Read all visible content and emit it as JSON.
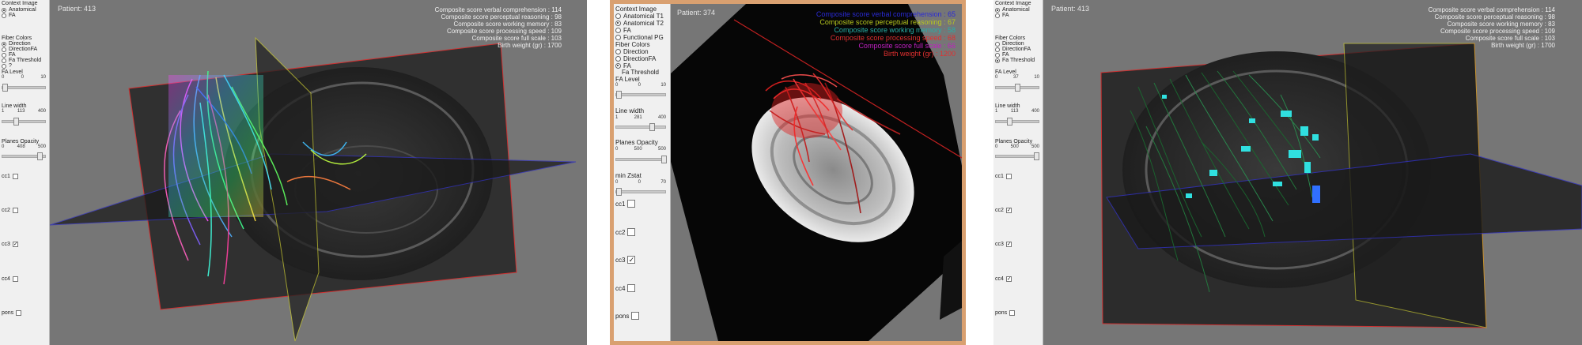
{
  "panel1": {
    "patient": "Patient: 413",
    "context_image": {
      "label": "Context Image",
      "options": [
        {
          "label": "Anatomical",
          "selected": true
        },
        {
          "label": "FA",
          "selected": false
        }
      ]
    },
    "fiber_colors": {
      "label": "Fiber Colors",
      "options": [
        {
          "label": "Direction",
          "selected": true
        },
        {
          "label": "DirectionFA",
          "selected": false
        },
        {
          "label": "FA",
          "selected": false
        },
        {
          "label": "Fa Threshold",
          "selected": false
        },
        {
          "label": "?",
          "selected": false
        }
      ]
    },
    "fa_level": {
      "label": "FA Level",
      "min": "0",
      "val": "0",
      "max": "10",
      "fraction": 0.0
    },
    "line_width": {
      "label": "Line width",
      "min": "1",
      "val": "113",
      "max": "400",
      "fraction": 0.28
    },
    "planes_opacity": {
      "label": "Planes Opacity",
      "min": "0",
      "val": "408",
      "max": "500",
      "fraction": 0.82
    },
    "checks": [
      {
        "label": "cc1",
        "checked": false
      },
      {
        "label": "cc2",
        "checked": false
      },
      {
        "label": "cc3",
        "checked": true
      },
      {
        "label": "cc4",
        "checked": false
      },
      {
        "label": "pons",
        "checked": false
      }
    ],
    "scores": [
      "Composite score verbal comprehension : 114",
      "Composite score perceptual reasoning : 98",
      "Composite score working memory : 83",
      "Composite score processing speed : 109",
      "Composite score full scale : 103",
      "Birth weight (gr) : 1700"
    ],
    "score_color": "#f0f0f0"
  },
  "panel2": {
    "patient": "Patient: 374",
    "context_image": {
      "label": "Context Image",
      "options": [
        {
          "label": "Anatomical T1",
          "selected": false
        },
        {
          "label": "Anatomical T2",
          "selected": true
        },
        {
          "label": "FA",
          "selected": false
        },
        {
          "label": "Functional PG",
          "selected": false
        }
      ]
    },
    "fiber_colors": {
      "label": "Fiber Colors",
      "options": [
        {
          "label": "Direction",
          "selected": false
        },
        {
          "label": "DirectionFA",
          "selected": false
        },
        {
          "label": "FA",
          "selected": true
        },
        {
          "label": "Fa Threshold",
          "selected": false
        }
      ]
    },
    "fa_level": {
      "label": "FA Level",
      "min": "0",
      "val": "0",
      "max": "10",
      "fraction": 0.0
    },
    "line_width": {
      "label": "Line width",
      "min": "1",
      "val": "281",
      "max": "400",
      "fraction": 0.7
    },
    "planes_opacity": {
      "label": "Planes Opacity",
      "min": "0",
      "val": "500",
      "max": "500",
      "fraction": 1.0
    },
    "min_zstat": {
      "label": "min Zstat",
      "min": "0",
      "val": "0",
      "max": "70",
      "fraction": 0.0
    },
    "checks": [
      {
        "label": "cc1",
        "checked": false
      },
      {
        "label": "cc2",
        "checked": false
      },
      {
        "label": "cc3",
        "checked": true
      },
      {
        "label": "cc4",
        "checked": false
      },
      {
        "label": "pons",
        "checked": false
      }
    ],
    "scores": [
      {
        "text": "Composite score verbal comprehension : 65",
        "color": "#2a2ad6"
      },
      {
        "text": "Composite score perceptual reasoning : 67",
        "color": "#b8c81e"
      },
      {
        "text": "Composite score working memory : 58",
        "color": "#27b0a8"
      },
      {
        "text": "Composite score processing speed : 68",
        "color": "#e03030"
      },
      {
        "text": "Composite score full scale : 66",
        "color": "#c020c0"
      },
      {
        "text": "Birth weight (gr) : 1200",
        "color": "#e03030"
      }
    ],
    "frame_color": "#d9a070"
  },
  "panel3": {
    "patient": "Patient: 413",
    "context_image": {
      "label": "Context Image",
      "options": [
        {
          "label": "Anatomical",
          "selected": true
        },
        {
          "label": "FA",
          "selected": false
        }
      ]
    },
    "fiber_colors": {
      "label": "Fiber Colors",
      "options": [
        {
          "label": "Direction",
          "selected": false
        },
        {
          "label": "DirectionFA",
          "selected": false
        },
        {
          "label": "FA",
          "selected": false
        },
        {
          "label": "Fa Threshold",
          "selected": true
        }
      ]
    },
    "fa_level": {
      "label": "FA Level",
      "min": "0",
      "val": "37",
      "max": "10",
      "fraction": 0.45
    },
    "line_width": {
      "label": "Line width",
      "min": "1",
      "val": "113",
      "max": "400",
      "fraction": 0.28
    },
    "planes_opacity": {
      "label": "Planes Opacity",
      "min": "0",
      "val": "500",
      "max": "500",
      "fraction": 1.0
    },
    "checks": [
      {
        "label": "cc1",
        "checked": false
      },
      {
        "label": "cc2",
        "checked": true
      },
      {
        "label": "cc3",
        "checked": true
      },
      {
        "label": "cc4",
        "checked": true
      },
      {
        "label": "pons",
        "checked": false
      }
    ],
    "scores": [
      "Composite score verbal comprehension : 114",
      "Composite score perceptual reasoning : 98",
      "Composite score working memory : 83",
      "Composite score processing speed : 109",
      "Composite score full scale : 103",
      "Birth weight (gr) : 1700"
    ],
    "score_color": "#f0f0f0"
  }
}
